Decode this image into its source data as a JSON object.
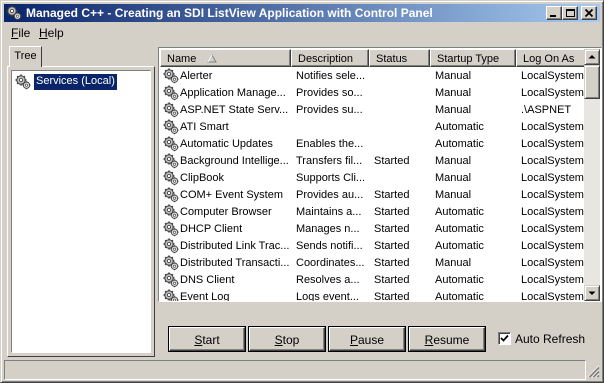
{
  "window": {
    "title": "Managed C++ - Creating an SDI ListView Application with Control Panel"
  },
  "menubar": {
    "items": [
      {
        "accel": "F",
        "rest": "ile"
      },
      {
        "accel": "H",
        "rest": "elp"
      }
    ]
  },
  "tree": {
    "tab_label": "Tree",
    "root_label": "Services (Local)"
  },
  "listview": {
    "columns": [
      "Name",
      "Description",
      "Status",
      "Startup Type",
      "Log On As"
    ],
    "sorted_column": "Name",
    "rows": [
      {
        "name": "Alerter",
        "description": "Notifies sele...",
        "status": "",
        "startup": "Manual",
        "logon": "LocalSystem"
      },
      {
        "name": "Application Manage...",
        "description": "Provides so...",
        "status": "",
        "startup": "Manual",
        "logon": "LocalSystem"
      },
      {
        "name": "ASP.NET State Serv...",
        "description": "Provides su...",
        "status": "",
        "startup": "Manual",
        "logon": ".\\ASPNET"
      },
      {
        "name": "ATI Smart",
        "description": "",
        "status": "",
        "startup": "Automatic",
        "logon": "LocalSystem"
      },
      {
        "name": "Automatic Updates",
        "description": "Enables the...",
        "status": "",
        "startup": "Automatic",
        "logon": "LocalSystem"
      },
      {
        "name": "Background Intellige...",
        "description": "Transfers fil...",
        "status": "Started",
        "startup": "Manual",
        "logon": "LocalSystem"
      },
      {
        "name": "ClipBook",
        "description": "Supports Cli...",
        "status": "",
        "startup": "Manual",
        "logon": "LocalSystem"
      },
      {
        "name": "COM+ Event System",
        "description": "Provides au...",
        "status": "Started",
        "startup": "Manual",
        "logon": "LocalSystem"
      },
      {
        "name": "Computer Browser",
        "description": "Maintains a...",
        "status": "Started",
        "startup": "Automatic",
        "logon": "LocalSystem"
      },
      {
        "name": "DHCP Client",
        "description": "Manages n...",
        "status": "Started",
        "startup": "Automatic",
        "logon": "LocalSystem"
      },
      {
        "name": "Distributed Link Trac...",
        "description": "Sends notifi...",
        "status": "Started",
        "startup": "Automatic",
        "logon": "LocalSystem"
      },
      {
        "name": "Distributed Transacti...",
        "description": "Coordinates...",
        "status": "Started",
        "startup": "Manual",
        "logon": "LocalSystem"
      },
      {
        "name": "DNS Client",
        "description": "Resolves a...",
        "status": "Started",
        "startup": "Automatic",
        "logon": "LocalSystem"
      },
      {
        "name": "Event Log",
        "description": "Logs event...",
        "status": "Started",
        "startup": "Automatic",
        "logon": "LocalSystem"
      }
    ]
  },
  "control_panel": {
    "buttons": [
      {
        "accel": "S",
        "rest": "tart"
      },
      {
        "accel": "S",
        "rest": "top",
        "pre": "",
        "accel_pos": "start"
      },
      {
        "accel": "P",
        "rest": "ause"
      },
      {
        "accel": "R",
        "rest": "esume"
      }
    ],
    "auto_refresh_label": "Auto Refresh",
    "auto_refresh_checked": true
  },
  "statusbar": {
    "text": ""
  },
  "colors": {
    "titlebar_start": "#0a246a",
    "titlebar_end": "#a6caf0",
    "face": "#d4d0c8",
    "selection": "#0a246a"
  },
  "icons": {
    "app": "gear-icon",
    "service": "service-gear-icon",
    "minimize": "minimize-icon",
    "maximize": "maximize-icon",
    "close": "close-icon"
  }
}
